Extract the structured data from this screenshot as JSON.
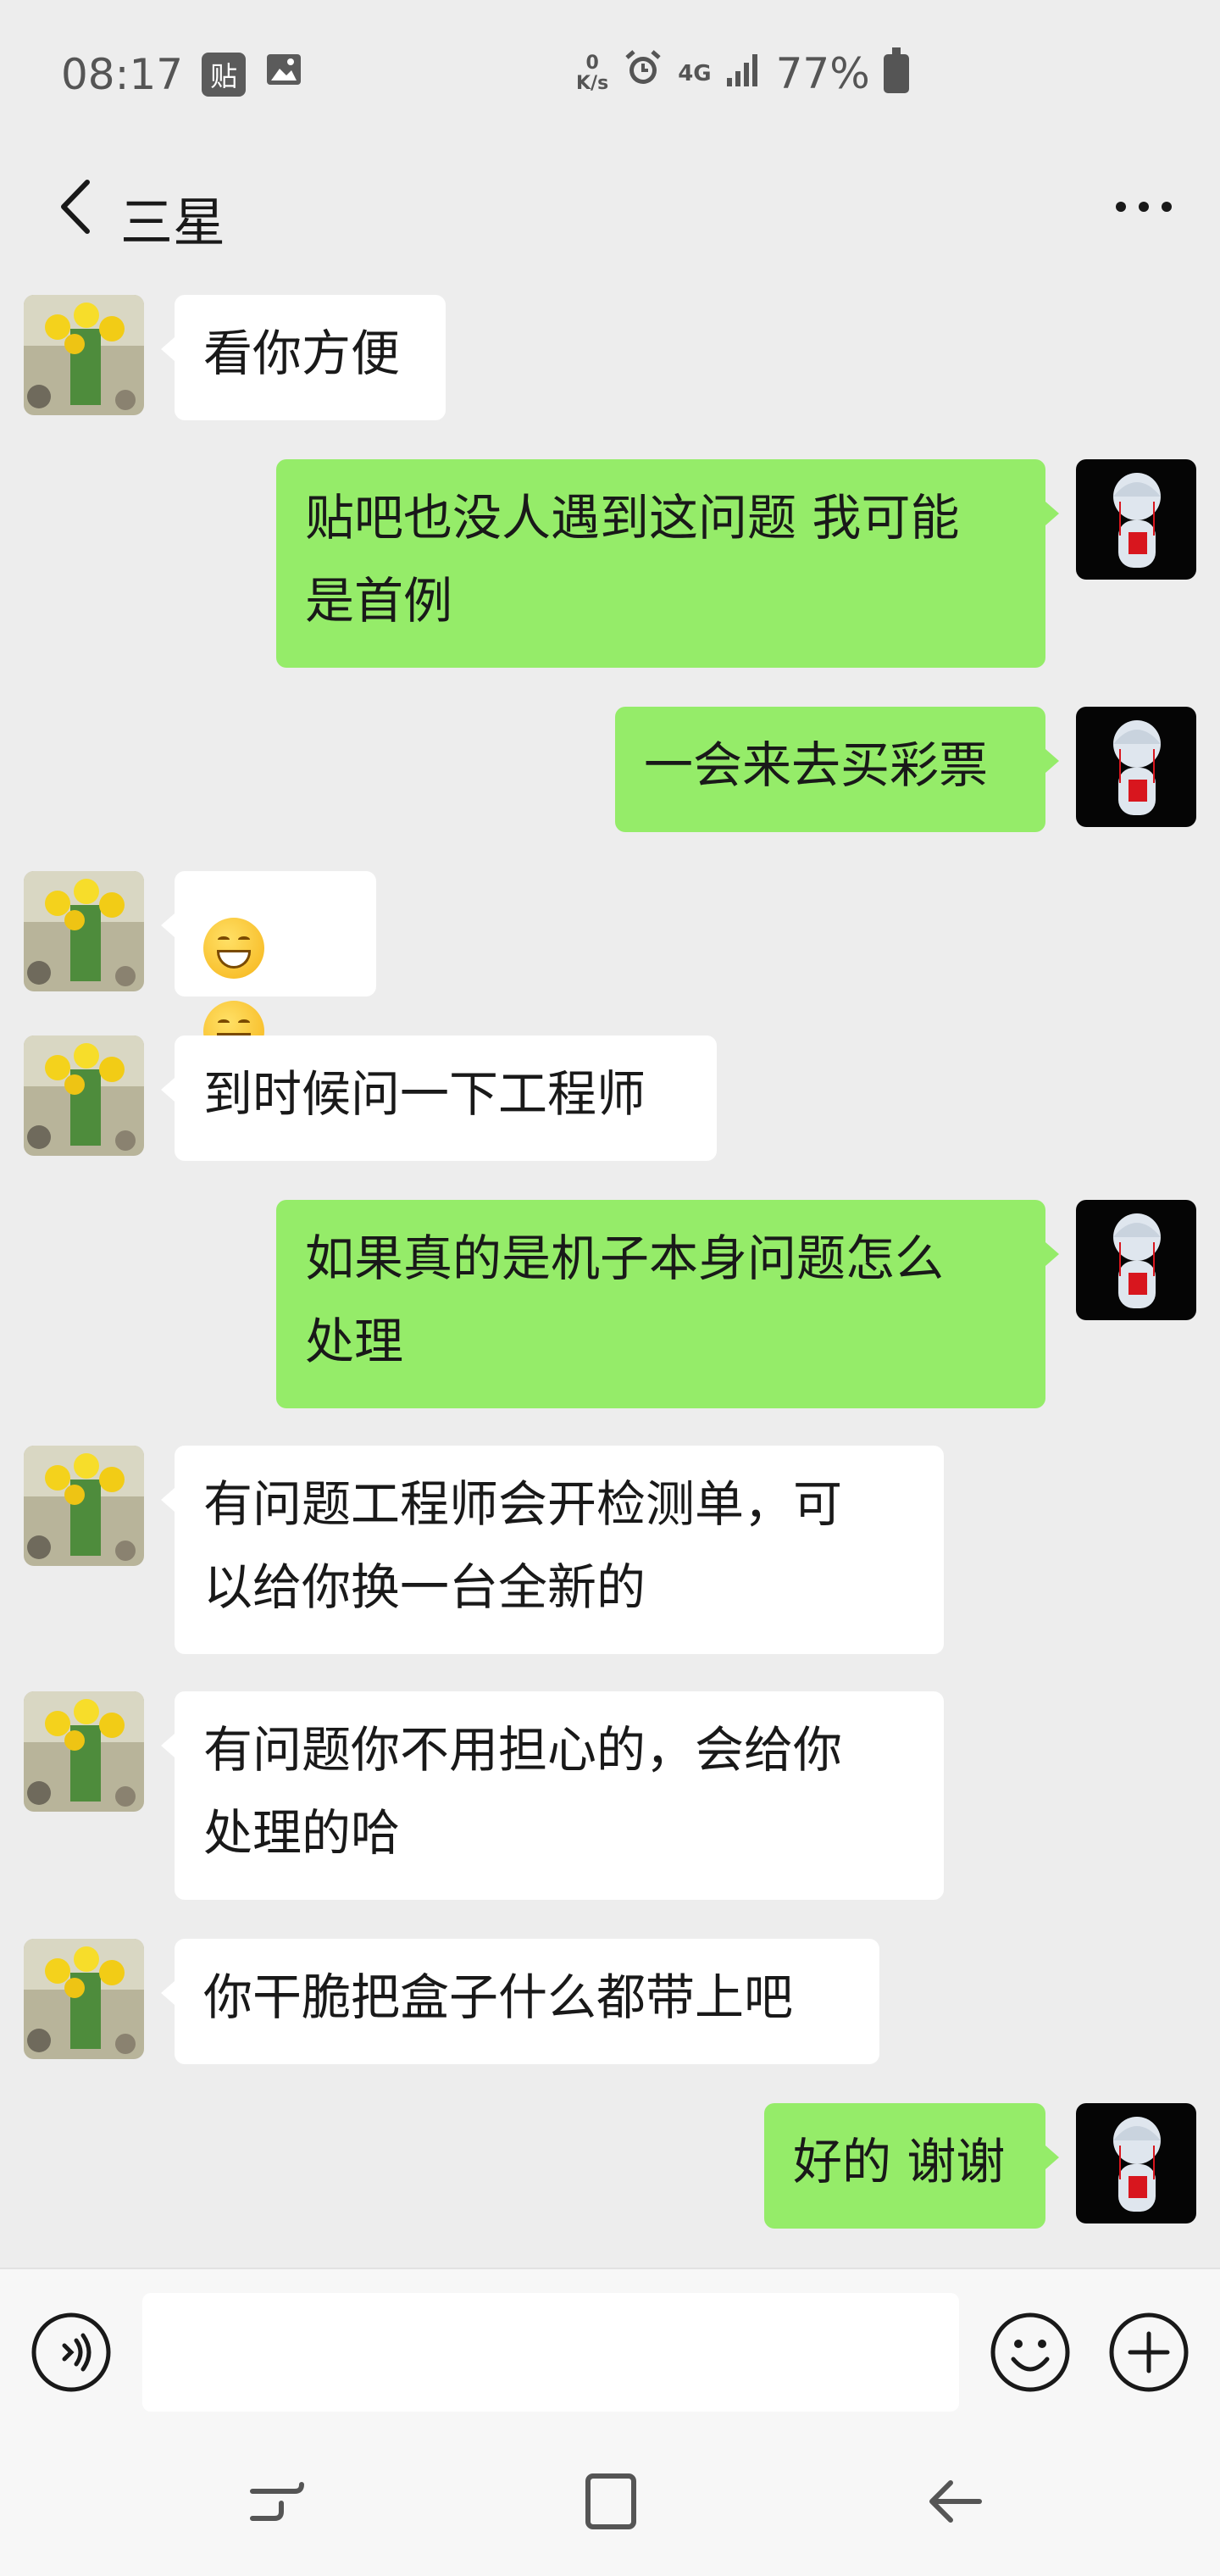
{
  "status_bar": {
    "time": "08:17",
    "badge_text": "贴",
    "net_speed_top": "0",
    "net_speed_bottom": "K/s",
    "network": "4G",
    "battery_percent": "77%"
  },
  "header": {
    "title": "三星",
    "more_icon": "more-horizontal-icon",
    "back_icon": "chevron-left-icon"
  },
  "colors": {
    "background": "#ededed",
    "incoming_bubble": "#ffffff",
    "outgoing_bubble": "#95ec69"
  },
  "messages": [
    {
      "sender": "them",
      "text": "看你方便"
    },
    {
      "sender": "me",
      "line1": "贴吧也没人遇到这问题 我可能",
      "line2": "是首例"
    },
    {
      "sender": "me",
      "text": "一会来去买彩票"
    },
    {
      "sender": "them",
      "emoji": "grinning-face-emoji",
      "emoji_count": 2
    },
    {
      "sender": "them",
      "text": "到时候问一下工程师"
    },
    {
      "sender": "me",
      "line1": "如果真的是机子本身问题怎么",
      "line2": "处理"
    },
    {
      "sender": "them",
      "line1": "有问题工程师会开检测单，可",
      "line2": "以给你换一台全新的"
    },
    {
      "sender": "them",
      "line1": "有问题你不用担心的，会给你",
      "line2": "处理的哈"
    },
    {
      "sender": "them",
      "text": "你干脆把盒子什么都带上吧"
    },
    {
      "sender": "me",
      "text": "好的 谢谢"
    }
  ],
  "input_bar": {
    "voice_icon": "voice-icon",
    "input_value": "",
    "emoji_icon": "emoji-icon",
    "plus_icon": "plus-icon"
  },
  "nav_bar": {
    "recents_icon": "recents-icon",
    "home_icon": "home-icon",
    "back_icon": "back-arrow-icon"
  }
}
